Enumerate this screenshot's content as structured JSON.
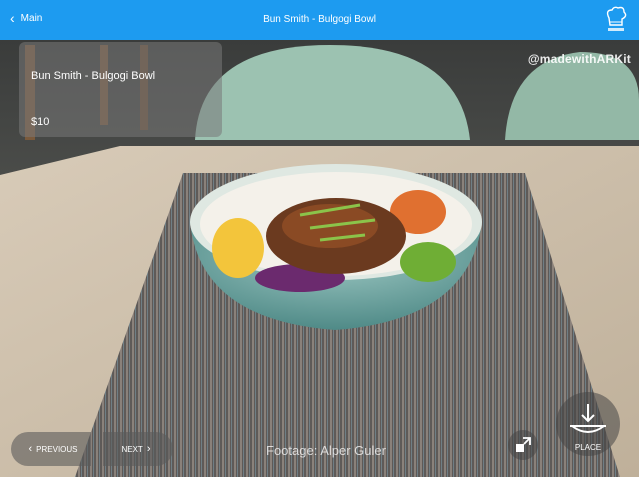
{
  "navbar": {
    "back_label": "Main",
    "title": "Bun Smith - Bulgogi Bowl",
    "background": "#1d9bf0"
  },
  "info_card": {
    "name": "Bun Smith - Bulgogi Bowl",
    "price": "$10"
  },
  "watermark": "@madewithARKit",
  "footage_credit": "Footage: Alper Guler",
  "controls": {
    "previous_label": "PREVIOUS",
    "next_label": "NEXT",
    "place_label": "PLACE",
    "icons": [
      "chevron-left-icon",
      "chevron-right-icon",
      "expand-icon",
      "place-down-arrow-icon",
      "chef-hat-logo-icon"
    ]
  }
}
